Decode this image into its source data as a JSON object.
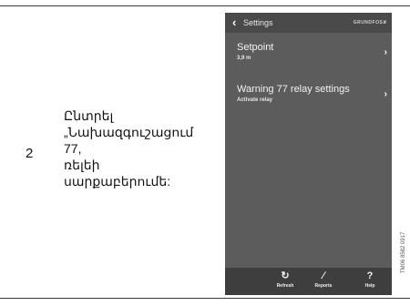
{
  "step": {
    "number": "2",
    "instruction": "Ընտրել\n„Նախազգուշացում 77,\nռելեի\nսարքաբերումե:"
  },
  "phone": {
    "header": {
      "back_icon": "chevron-left-icon",
      "title": "Settings",
      "logo": "GRUNDFOS✘"
    },
    "menu": [
      {
        "title": "Setpoint",
        "value": "3,9 m",
        "chevron": "chevron-right-icon"
      },
      {
        "title": "Warning 77 relay settings",
        "value": "Activate relay",
        "chevron": "chevron-right-icon"
      }
    ],
    "bottom_bar": [
      {
        "icon": "refresh-icon",
        "label": "Refresh"
      },
      {
        "icon": "reports-icon",
        "label": "Reports"
      },
      {
        "icon": "help-icon",
        "label": "Help"
      }
    ],
    "colors": {
      "screen_background": "#5c5c5c",
      "header_background": "#4a4a4a",
      "bottom_bar_background": "#3e3e3e",
      "text": "#f2f2f2"
    }
  },
  "figure_code": "TM06 8582 0917"
}
